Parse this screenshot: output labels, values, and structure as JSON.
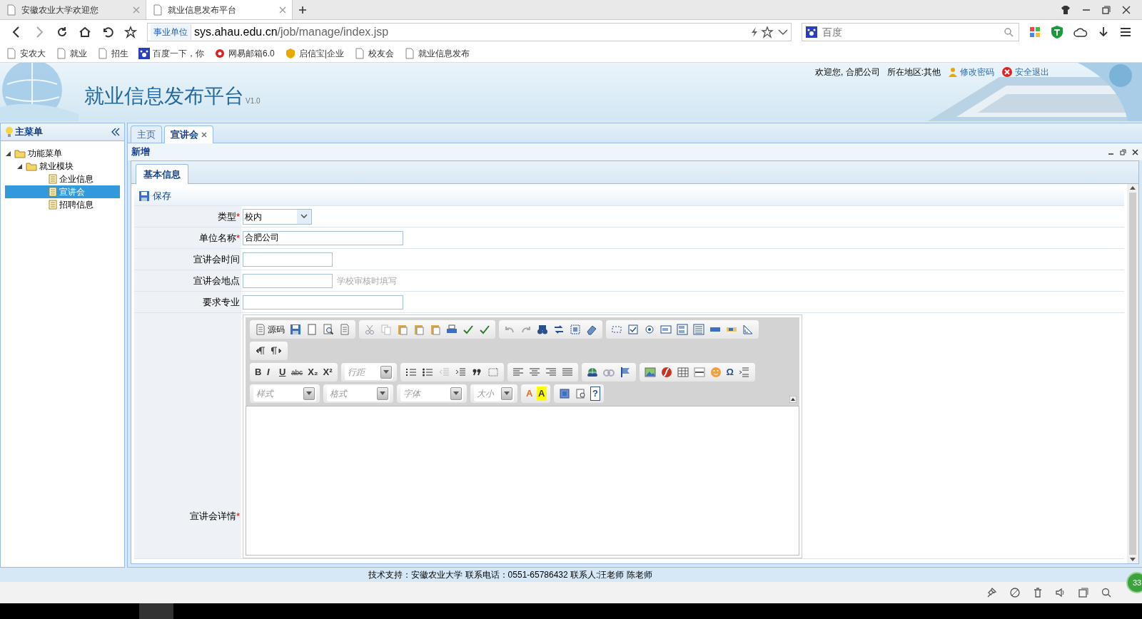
{
  "browser": {
    "tabs": [
      {
        "title": "安徽农业大学欢迎您",
        "selected": false
      },
      {
        "title": "就业信息发布平台",
        "selected": true
      }
    ],
    "address": {
      "badge": "事业单位",
      "url_host": "sys.ahau.edu.cn",
      "url_path": "/job/manage/index.jsp"
    },
    "search": {
      "placeholder": "百度"
    },
    "bookmarks": [
      {
        "label": "安农大",
        "kind": "page"
      },
      {
        "label": "就业",
        "kind": "page"
      },
      {
        "label": "招生",
        "kind": "page"
      },
      {
        "label": "百度一下，你",
        "kind": "paw"
      },
      {
        "label": "网易邮箱6.0",
        "kind": "mail"
      },
      {
        "label": "启信宝|企业",
        "kind": "shield"
      },
      {
        "label": "校友会",
        "kind": "page"
      },
      {
        "label": "就业信息发布",
        "kind": "page"
      }
    ]
  },
  "header": {
    "title": "就业信息发布平台",
    "version": "V1.0",
    "welcome": "欢迎您, 合肥公司",
    "region": "所在地区:其他",
    "links": [
      {
        "label": "修改密码",
        "kind": "user"
      },
      {
        "label": "安全退出",
        "kind": "exit"
      }
    ]
  },
  "sidebar": {
    "title": "主菜单",
    "tree": [
      {
        "label": "功能菜单",
        "kind": "folder",
        "expanded": true,
        "children": [
          {
            "label": "就业模块",
            "kind": "folder",
            "expanded": true,
            "children": [
              {
                "label": "企业信息",
                "kind": "page",
                "selected": false
              },
              {
                "label": "宣讲会",
                "kind": "page",
                "selected": true
              },
              {
                "label": "招聘信息",
                "kind": "page",
                "selected": false
              }
            ]
          }
        ]
      }
    ]
  },
  "tabs": [
    {
      "label": "主页",
      "selected": false,
      "closable": false
    },
    {
      "label": "宣讲会",
      "selected": true,
      "closable": true
    }
  ],
  "panel": {
    "title": "新增",
    "subtabs": [
      {
        "label": "基本信息",
        "selected": true
      }
    ],
    "save_label": "保存"
  },
  "form": [
    {
      "label": "类型",
      "required_mark": "*",
      "kind": "select",
      "value": "校内"
    },
    {
      "label": "单位名称",
      "required_mark": "*",
      "kind": "text",
      "value": "合肥公司"
    },
    {
      "label": "宣讲会时间",
      "kind": "text"
    },
    {
      "label": "宣讲会地点",
      "kind": "text",
      "hint": "学校审核时填写"
    },
    {
      "label": "要求专业",
      "kind": "text"
    }
  ],
  "editor": {
    "label": "宣讲会详情",
    "required_mark": "*",
    "source_label": "源码",
    "format_glyphs": [
      "B",
      "I",
      "U",
      "abc",
      "X₂",
      "X²"
    ],
    "combos": [
      {
        "placeholder": "行距"
      },
      {
        "placeholder": "样式"
      },
      {
        "placeholder": "格式"
      },
      {
        "placeholder": "字体"
      },
      {
        "placeholder": "大小"
      }
    ],
    "symbol_glyph": "Ω",
    "color_glyphs": [
      "A",
      "A"
    ],
    "help_glyph": "?"
  },
  "footer": "技术支持：安徽农业大学 联系电话：0551-65786432 联系人:汪老师 陈老师",
  "status_badge": "33"
}
